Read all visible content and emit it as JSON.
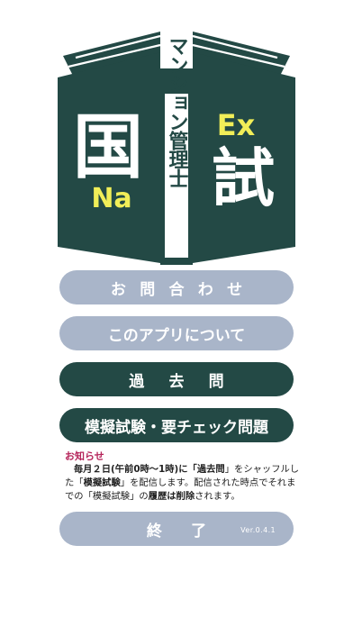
{
  "logo": {
    "left_char": "国",
    "left_sub": "Na",
    "right_top": "Ex",
    "right_char": "試",
    "spine": "マンション管理士",
    "colors": {
      "cover": "#234945",
      "accent": "#f1ee58",
      "spine_bg": "#ffffff"
    }
  },
  "buttons": {
    "contact": "お問合わせ",
    "about": "このアプリについて",
    "past": "過去問",
    "mock": "模擬試験・要チェック問題",
    "exit": "終了",
    "version": "Ver.0.4.1"
  },
  "notice": {
    "title": "お知らせ",
    "p1": "毎月２日(午前0時〜1時)に「",
    "p1b": "過去問",
    "p2": "」をシャッフルした「",
    "p2b": "模擬試験",
    "p3": "」を配信します。配信された時点でそれまでの「模擬試験」の",
    "p3b": "履歴は削除",
    "p4": "されます。"
  }
}
